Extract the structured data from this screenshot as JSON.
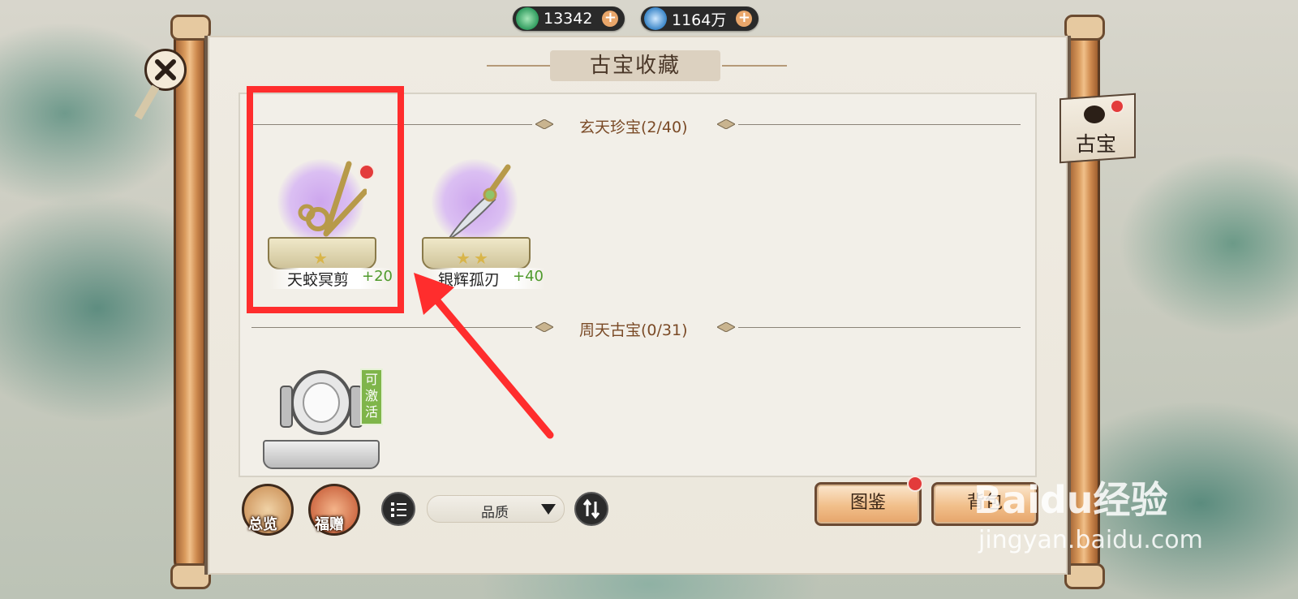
{
  "resources": [
    {
      "name": "jade-coin",
      "value": "13342",
      "color": "#3fa86a"
    },
    {
      "name": "spirit-crystal",
      "value": "1164万",
      "color": "#3a86c8"
    }
  ],
  "header": {
    "title": "古宝收藏"
  },
  "side_tab": {
    "label": "古宝"
  },
  "sections": [
    {
      "title": "玄天珍宝(2/40)"
    },
    {
      "title": "周天古宝(0/31)"
    }
  ],
  "items": [
    {
      "name": "天蛟冥剪",
      "bonus": "+20",
      "stars": 1,
      "has_alert": true
    },
    {
      "name": "银辉孤刃",
      "bonus": "+40",
      "stars": 2,
      "has_alert": false
    }
  ],
  "locked_item": {
    "badge": "可激活"
  },
  "bottom_bar": {
    "overview_label": "总览",
    "gift_label": "福赠",
    "quality_select": "品质",
    "codex_label": "图鉴",
    "backpack_label": "背包"
  },
  "watermark": {
    "logo": "Baidu经验",
    "url": "jingyan.baidu.com"
  },
  "colors": {
    "highlight": "#ff2d2d",
    "bonus": "#4f9a2c",
    "section_title": "#7a4a26"
  }
}
